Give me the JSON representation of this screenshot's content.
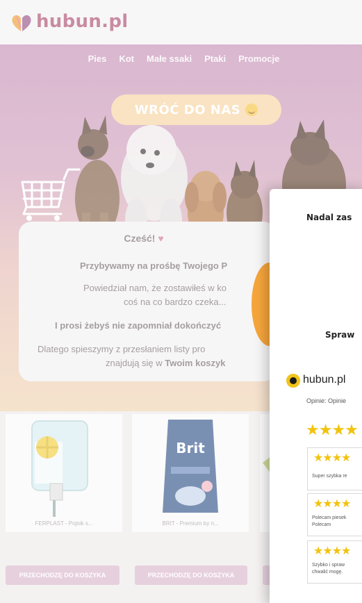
{
  "brand": {
    "name": "hubun.pl"
  },
  "nav": {
    "items": [
      "Pies",
      "Kot",
      "Małe ssaki",
      "Ptaki",
      "Promocje"
    ]
  },
  "hero": {
    "cta_label": "WRÓĆ DO NAS"
  },
  "message": {
    "greeting": "Cześć!",
    "line1": "Przybywamy na prośbę Twojego P",
    "line2": "Powiedział nam, że zostawiłeś w ko",
    "line3": "coś na co bardzo czeka...",
    "line4": "I prosi żebyś nie zapomniał dokończyć",
    "line5": "Dlatego spieszymy z przesłaniem listy pro",
    "line6_a": "znajdują się w ",
    "line6_b": "Twoim koszyk"
  },
  "products": [
    {
      "name": "FERPLAST - Pojnik s...",
      "button": "PRZECHODZĘ DO KOSZYKA"
    },
    {
      "name": "BRIT - Premium by n...",
      "button": "PRZECHODZĘ DO KOSZYKA"
    }
  ],
  "modal": {
    "title": "Nadal zas",
    "subtitle": "Spraw"
  },
  "widget": {
    "brand": "hubun.pl",
    "opinie": "Opinie: Opinie",
    "stars": "★★★★",
    "reviews": [
      {
        "stars": "★★★★",
        "text1": "Super szybka re",
        "text2": ""
      },
      {
        "stars": "★★★★",
        "text1": "Polecam piesek",
        "text2": "Polecam"
      },
      {
        "stars": "★★★★",
        "text1": "Szybko i spraw",
        "text2": "chwalić mogę."
      }
    ]
  },
  "colors": {
    "brand": "#b05575",
    "accent": "#f6a53c",
    "star": "#f1c30c",
    "button": "#dcbacf"
  }
}
